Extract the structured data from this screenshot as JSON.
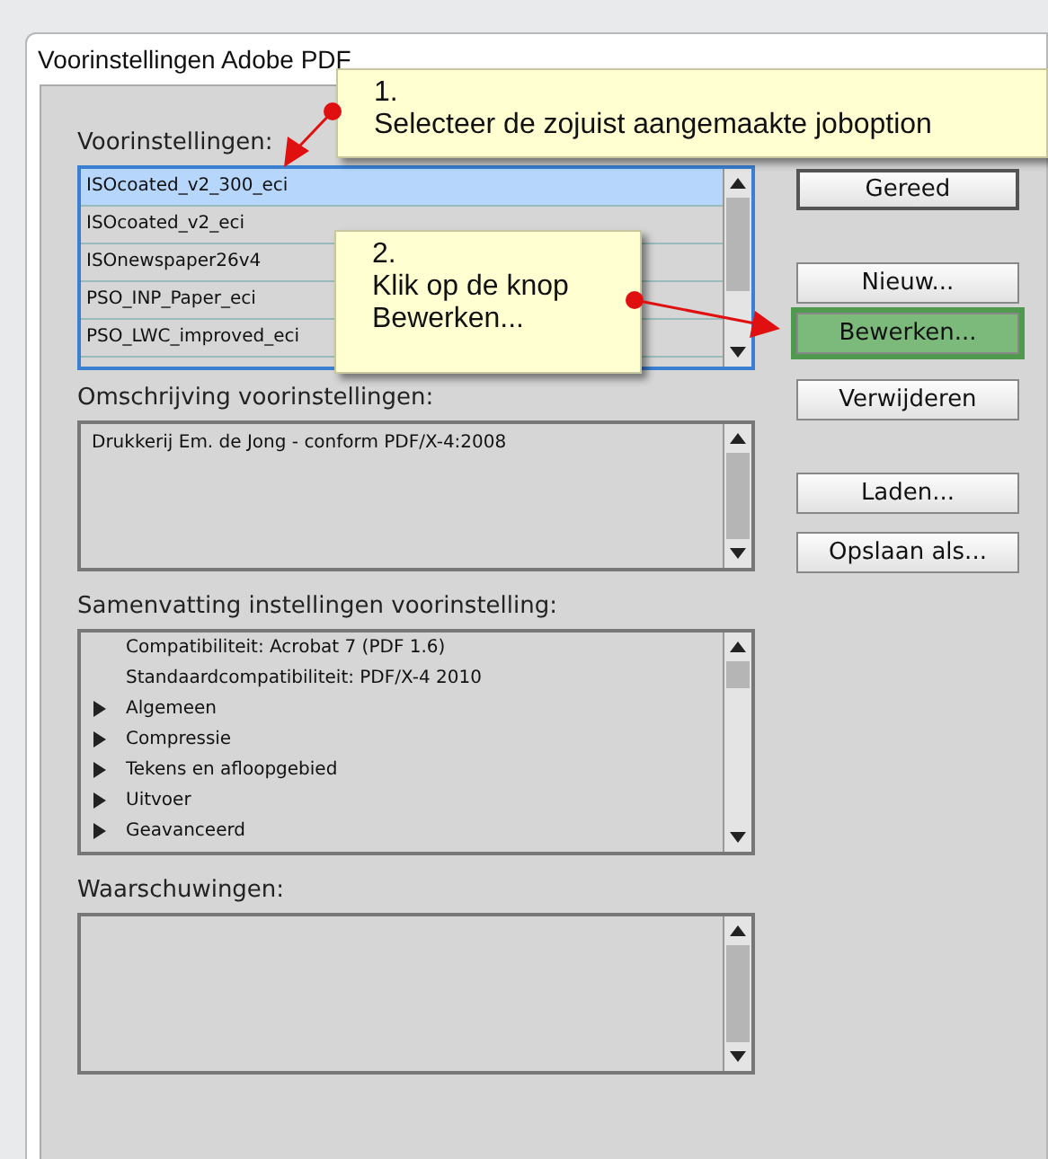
{
  "window": {
    "title": "Voorinstellingen Adobe PDF"
  },
  "presets": {
    "label": "Voorinstellingen:",
    "items": [
      {
        "label": "ISOcoated_v2_300_eci",
        "selected": true
      },
      {
        "label": "ISOcoated_v2_eci",
        "selected": false
      },
      {
        "label": "ISOnewspaper26v4",
        "selected": false
      },
      {
        "label": "PSO_INP_Paper_eci",
        "selected": false
      },
      {
        "label": "PSO_LWC_improved_eci",
        "selected": false
      }
    ]
  },
  "description": {
    "label": "Omschrijving voorinstellingen:",
    "text": "Drukkerij Em. de Jong - conform PDF/X-4:2008"
  },
  "summary": {
    "label": "Samenvatting instellingen voorinstelling:",
    "items": [
      {
        "kind": "leaf",
        "label": "Compatibiliteit: Acrobat 7 (PDF 1.6)"
      },
      {
        "kind": "leaf",
        "label": "Standaardcompatibiliteit: PDF/X-4 2010"
      },
      {
        "kind": "group",
        "label": "Algemeen",
        "expanded": false
      },
      {
        "kind": "group",
        "label": "Compressie",
        "expanded": false
      },
      {
        "kind": "group",
        "label": "Tekens en afloopgebied",
        "expanded": false
      },
      {
        "kind": "group",
        "label": "Uitvoer",
        "expanded": false
      },
      {
        "kind": "group",
        "label": "Geavanceerd",
        "expanded": false
      }
    ]
  },
  "warnings": {
    "label": "Waarschuwingen:"
  },
  "buttons": [
    {
      "label": "Gereed",
      "default": true,
      "highlighted": false
    },
    {
      "label": "Nieuw...",
      "default": false,
      "highlighted": false
    },
    {
      "label": "Bewerken...",
      "default": false,
      "highlighted": true
    },
    {
      "label": "Verwijderen",
      "default": false,
      "highlighted": false
    },
    {
      "label": "Laden...",
      "default": false,
      "highlighted": false
    },
    {
      "label": "Opslaan als...",
      "default": false,
      "highlighted": false
    }
  ],
  "callouts": [
    {
      "number": "1.",
      "text": "Selecteer de zojuist aangemaakte joboption"
    },
    {
      "number": "2.",
      "text": "Klik op de knop Bewerken..."
    }
  ]
}
